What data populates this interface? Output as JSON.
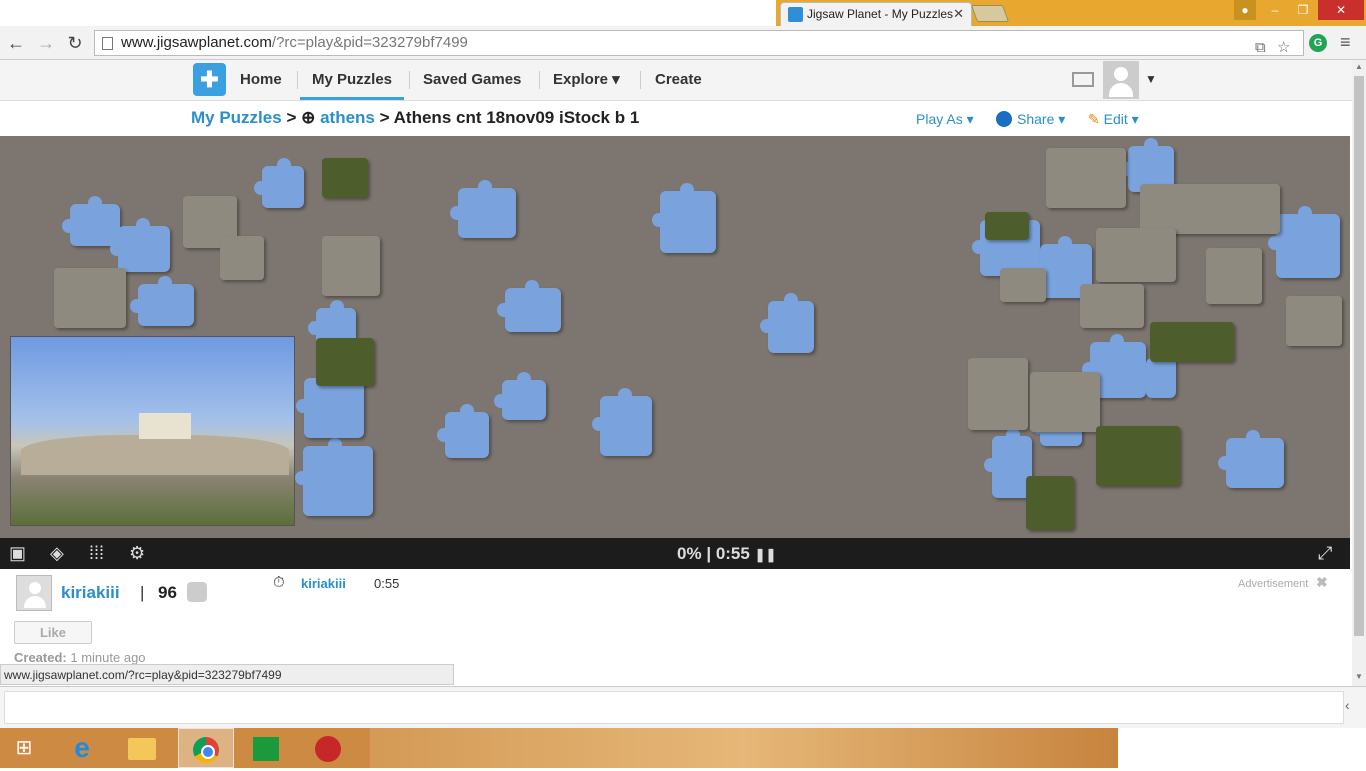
{
  "browser": {
    "tab_title": "Jigsaw Planet - My Puzzles",
    "tab_close": "✕",
    "url_host": "www.jigsawplanet.com",
    "url_path": "/?rc=play&pid=323279bf7499",
    "window_controls": {
      "minimize": "‒",
      "maximize": "❐",
      "close": "✕"
    },
    "extension_label": "G"
  },
  "site_nav": {
    "items": [
      {
        "label": "Home"
      },
      {
        "label": "My Puzzles"
      },
      {
        "label": "Saved Games"
      },
      {
        "label": "Explore ▾"
      },
      {
        "label": "Create"
      }
    ]
  },
  "breadcrumb": {
    "root": "My Puzzles",
    "sep1": ">",
    "folder": "athens",
    "sep2": ">",
    "current": "Athens cnt 18nov09 iStock b 1"
  },
  "actions": {
    "play_as": "Play As ▾",
    "share": "Share ▾",
    "edit": "Edit ▾"
  },
  "game": {
    "progress": "0%",
    "separator": "|",
    "time": "0:55",
    "progress_value": 0
  },
  "info": {
    "owner": "kiriakiii",
    "owner_sep": "|",
    "score": "96",
    "player": "kiriakiii",
    "player_time": "0:55",
    "advertisement": "Advertisement",
    "like_label": "Like",
    "created_label": "Created:",
    "created_value": "1 minute ago"
  },
  "status_bar": {
    "text": "www.jigsawplanet.com/?rc=play&pid=323279bf7499"
  },
  "colors": {
    "accent": "#2a8fcc",
    "piece_blue": "#7aa3dd",
    "board": "#7d7670",
    "titlebar": "#e8a830"
  },
  "icons": [
    "back-icon",
    "forward-icon",
    "reload-icon",
    "star-icon",
    "mail-icon",
    "picture-icon",
    "ghost-icon",
    "grid-icon",
    "gear-icon",
    "pause-icon",
    "fullscreen-icon",
    "timer-icon"
  ]
}
